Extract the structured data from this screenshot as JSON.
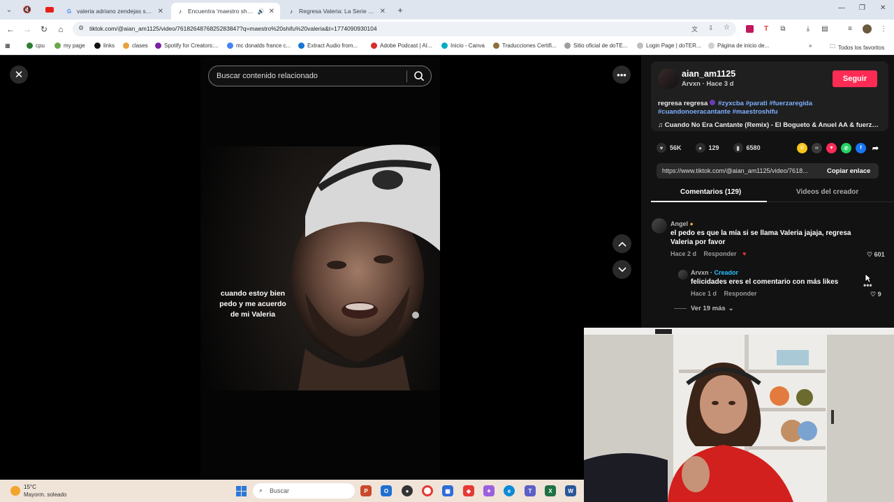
{
  "browser": {
    "tabs": [
      {
        "label": "valeria adriano zendejas shifu - ",
        "active": false
      },
      {
        "label": "Encuentra 'maestro shifu va",
        "active": true
      },
      {
        "label": "Regresa Valeria: La Serie con Ad",
        "active": false
      }
    ],
    "url": "tiktok.com/@aian_am1125/video/7618264876825283847?q=maestro%20shifu%20valeria&t=1774090930104",
    "bookmarks": [
      "cpu",
      "my page",
      "links",
      "clases",
      "Spotify for Creators:...",
      "mc donalds france c...",
      "Extract Audio from...",
      "Adobe Podcast | AI...",
      "Inicio - Canva",
      "Traducciones Certifi...",
      "Sitio oficial de doTE...",
      "Login Page | doTER...",
      "Página de inicio de..."
    ],
    "all_favorites": "Todos los favoritos"
  },
  "player": {
    "search_placeholder": "Buscar contenido relacionado",
    "caption": "cuando estoy bien pedo y me acuerdo de mi Valeria"
  },
  "author": {
    "username": "aian_am1125",
    "subline": "Arvxn · Hace 3 d",
    "follow_label": "Seguir",
    "desc_text": "regresa regresa ",
    "hashtags_line1": "#zyxcba #parati #fuerzaregida",
    "hashtags_line2": "#cuandonoeracantante #maestroshifu",
    "music": "♫  Cuando No Era Cantante (Remix) - El Bogueto & Anuel AA & fuerza..."
  },
  "stats": {
    "likes": "56K",
    "comments": "129",
    "saves": "6580"
  },
  "link": {
    "url": "https://www.tiktok.com/@aian_am1125/video/7618...",
    "copy_label": "Copiar enlace"
  },
  "tabs": {
    "comments": "Comentarios (129)",
    "creator_videos": "Videos del creador"
  },
  "comments": [
    {
      "name": "Angel",
      "text": "el pedo es que la mía si se llama Valeria jajaja, regresa Valeria por favor",
      "time": "Hace 2 d",
      "reply": "Responder",
      "likes": "601"
    }
  ],
  "reply": {
    "name": "Arvxn",
    "badge": "Creador",
    "text": "felicidades eres el comentario con más likes",
    "time": "Hace 1 d",
    "reply": "Responder",
    "likes": "9"
  },
  "view_more": "Ver 19 más",
  "taskbar": {
    "temp": "15°C",
    "weather": "Mayorm. soleado",
    "search_placeholder": "Buscar"
  },
  "colors": {
    "accent": "#fe2c55",
    "hashtag": "#7fb0ff",
    "creator_badge": "#2ac0ff"
  }
}
